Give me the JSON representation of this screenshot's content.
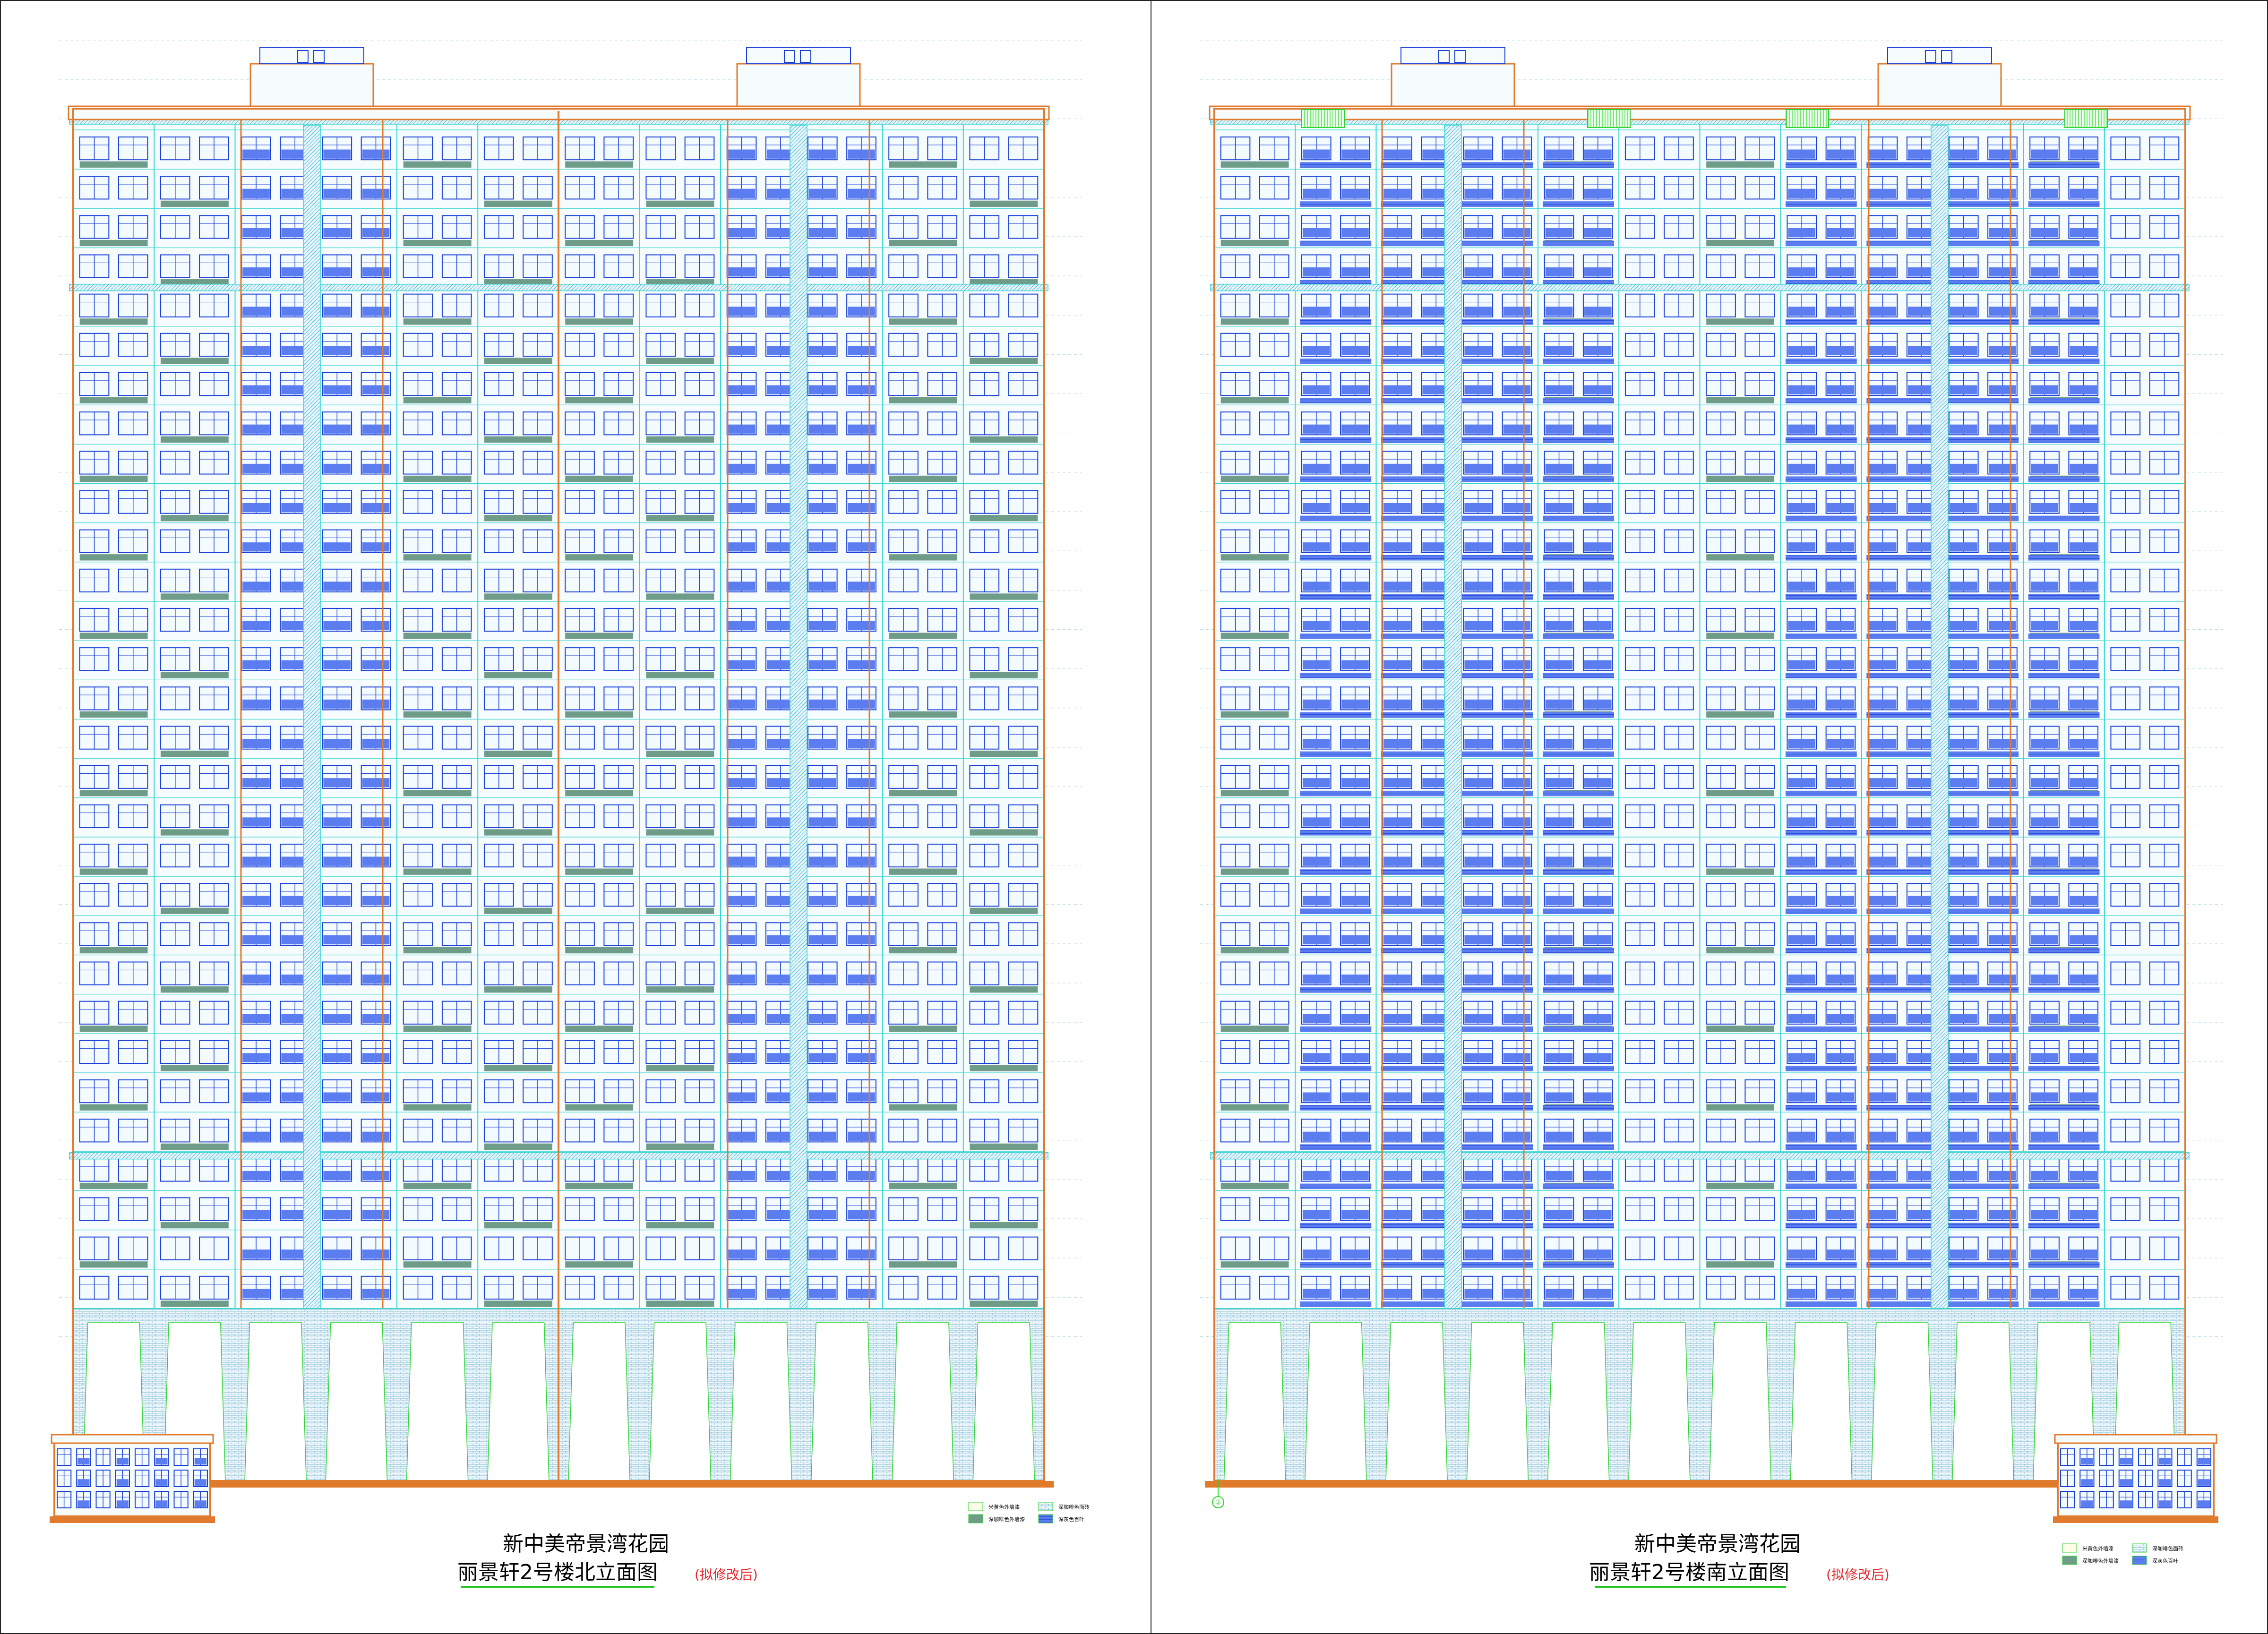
{
  "sheets": [
    {
      "project_title": "新中美帝景湾花园",
      "drawing_title": "丽景轩2号楼北立面图",
      "note": "(拟修改后)",
      "legend": [
        "米黄色外墙漆",
        "深咖啡色面砖",
        "深咖啡色外墙漆",
        "深灰色百叶"
      ]
    },
    {
      "project_title": "新中美帝景湾花园",
      "drawing_title": "丽景轩2号楼南立面图",
      "note": "(拟修改后)",
      "legend": [
        "米黄色外墙漆",
        "深咖啡色面砖",
        "深咖啡色外墙漆",
        "深灰色百叶"
      ]
    }
  ],
  "axis_marker": "①",
  "colors": {
    "outline": "#e07a2c",
    "window": "#1a3fd6",
    "glass": "#5b7df0",
    "trim": "#37d4d0",
    "panel": "#6f9c88",
    "green": "#2fd22f",
    "title_underline": "#22c522",
    "note": "#e8262a"
  }
}
